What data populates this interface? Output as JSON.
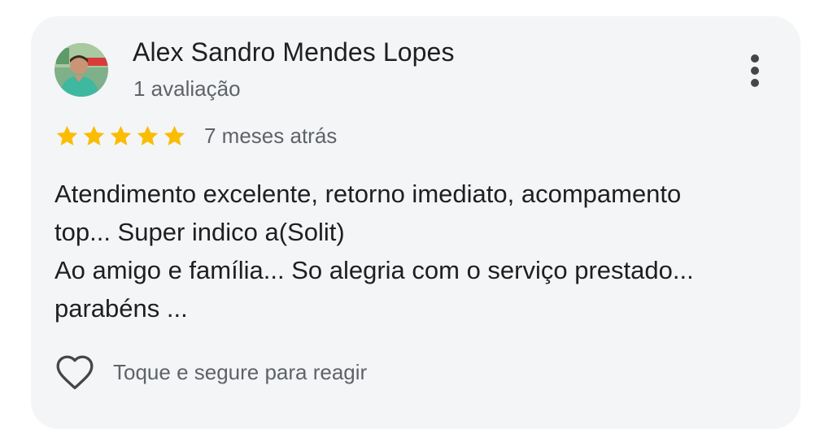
{
  "review": {
    "author_name": "Alex Sandro Mendes Lopes",
    "author_reviews": "1 avaliação",
    "avatar": "profile-photo",
    "rating": 5,
    "rating_max": 5,
    "date": "7 meses atrás",
    "text_lines": [
      "Atendimento excelente, retorno imediato, acompamento",
      "top... Super indico a(Solit)",
      "Ao amigo e família... So alegria com o serviço prestado...",
      "parabéns ..."
    ],
    "reaction_hint": "Toque e segure para reagir"
  },
  "icons": {
    "more": "more-vert-icon",
    "reaction": "heart-outline-icon",
    "star": "star-filled-icon"
  },
  "colors": {
    "card_background": "#f4f5f7",
    "star": "#fbbc04",
    "primary_text": "#1f1f1f",
    "secondary_text": "#5f6368",
    "icon": "#444746"
  }
}
